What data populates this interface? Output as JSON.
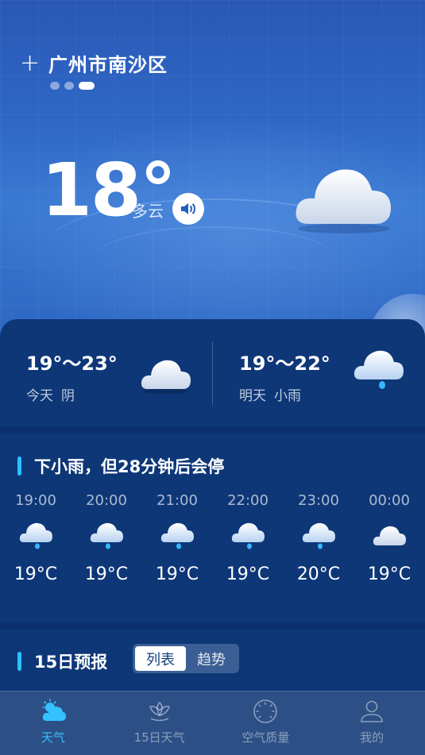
{
  "header": {
    "city": "广州市南沙区",
    "add_icon": "plus-icon"
  },
  "current": {
    "temp": "18°",
    "condition": "多云"
  },
  "days": [
    {
      "range": "19°～23°",
      "day": "今天",
      "condition": "阴"
    },
    {
      "range": "19°～22°",
      "day": "明天",
      "condition": "小雨"
    }
  ],
  "alert": "下小雨，但28分钟后会停",
  "hourly": [
    {
      "time": "19:00",
      "temp": "19°C",
      "icon": "light-rain-icon"
    },
    {
      "time": "20:00",
      "temp": "19°C",
      "icon": "light-rain-icon"
    },
    {
      "time": "21:00",
      "temp": "19°C",
      "icon": "light-rain-icon"
    },
    {
      "time": "22:00",
      "temp": "19°C",
      "icon": "light-rain-icon"
    },
    {
      "time": "23:00",
      "temp": "20°C",
      "icon": "light-rain-icon"
    },
    {
      "time": "00:00",
      "temp": "19°C",
      "icon": "cloudy-icon"
    }
  ],
  "forecast": {
    "title": "15日预报",
    "toggle_list": "列表",
    "toggle_trend": "趋势"
  },
  "tabs": [
    {
      "label": "天气",
      "icon": "weather-icon"
    },
    {
      "label": "15日天气",
      "icon": "lotus-icon"
    },
    {
      "label": "空气质量",
      "icon": "dial-icon"
    },
    {
      "label": "我的",
      "icon": "user-icon"
    }
  ],
  "colors": {
    "accent": "#33c2ff",
    "card": "#0e3778",
    "tabbar": "#2c4f86"
  }
}
